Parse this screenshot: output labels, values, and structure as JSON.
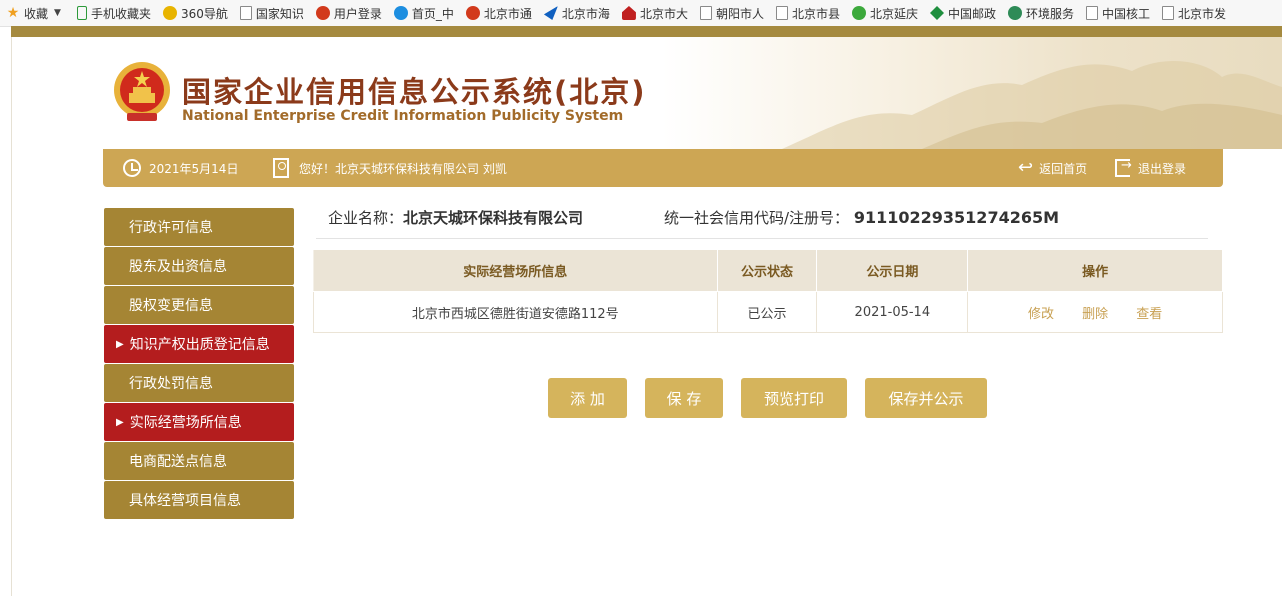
{
  "bookmarks": [
    {
      "label": "收藏",
      "icon": "star-icon"
    },
    {
      "label": "手机收藏夹",
      "icon": "phone-icon"
    },
    {
      "label": "360导航",
      "icon": "browser-360-icon"
    },
    {
      "label": "国家知识",
      "icon": "page-icon"
    },
    {
      "label": "用户登录",
      "icon": "emblem-icon"
    },
    {
      "label": "首页_中",
      "icon": "ie-icon"
    },
    {
      "label": "北京市通",
      "icon": "emblem-icon"
    },
    {
      "label": "北京市海",
      "icon": "bird-icon"
    },
    {
      "label": "北京市大",
      "icon": "house-icon"
    },
    {
      "label": "朝阳市人",
      "icon": "page-icon"
    },
    {
      "label": "北京市县",
      "icon": "page-icon"
    },
    {
      "label": "北京延庆",
      "icon": "green-circle-icon"
    },
    {
      "label": "中国邮政",
      "icon": "post-icon"
    },
    {
      "label": "环境服务",
      "icon": "env-icon"
    },
    {
      "label": "中国核工",
      "icon": "page-icon"
    },
    {
      "label": "北京市发",
      "icon": "page-icon"
    }
  ],
  "header": {
    "title_cn": "国家企业信用信息公示系统(北京)",
    "title_en": "National Enterprise Credit Information Publicity System"
  },
  "infobar": {
    "date": "2021年5月14日",
    "greeting": "您好！北京天城环保科技有限公司 刘凯",
    "home_label": "返回首页",
    "logout_label": "退出登录"
  },
  "nav": [
    {
      "label": "行政许可信息",
      "active": false
    },
    {
      "label": "股东及出资信息",
      "active": false
    },
    {
      "label": "股权变更信息",
      "active": false
    },
    {
      "label": "知识产权出质登记信息",
      "active": true
    },
    {
      "label": "行政处罚信息",
      "active": false
    },
    {
      "label": "实际经营场所信息",
      "active": true
    },
    {
      "label": "电商配送点信息",
      "active": false
    },
    {
      "label": "具体经营项目信息",
      "active": false
    }
  ],
  "company": {
    "name_label": "企业名称：",
    "name": "北京天城环保科技有限公司",
    "code_label": "统一社会信用代码/注册号：",
    "code": "91110229351274265M"
  },
  "table": {
    "headers": [
      "实际经营场所信息",
      "公示状态",
      "公示日期",
      "操作"
    ],
    "rows": [
      {
        "address": "北京市西城区德胜街道安德路112号",
        "status": "已公示",
        "date": "2021-05-14",
        "ops": [
          "修改",
          "删除",
          "查看"
        ]
      }
    ]
  },
  "buttons": {
    "add": "添 加",
    "save": "保 存",
    "preview_print": "预览打印",
    "save_publish": "保存并公示"
  },
  "colors": {
    "accent_gold": "#cda654",
    "nav_brown": "#a58534",
    "nav_active_red": "#b41d1e",
    "title_red": "#8b3a1a"
  }
}
